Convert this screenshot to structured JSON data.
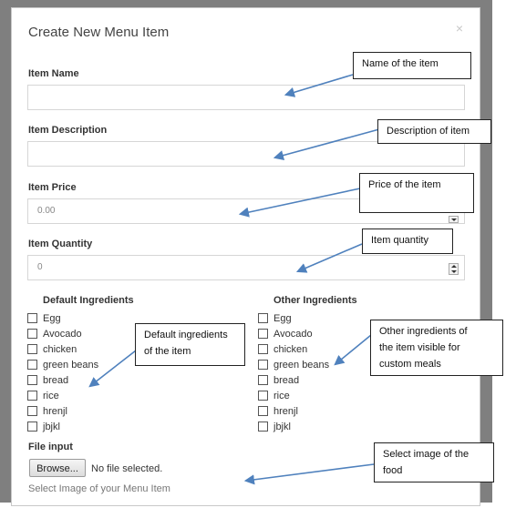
{
  "modal": {
    "title": "Create New Menu Item",
    "close_label": "×"
  },
  "form": {
    "name": {
      "label": "Item Name",
      "value": "",
      "placeholder": ""
    },
    "description": {
      "label": "Item Description",
      "value": "",
      "placeholder": ""
    },
    "price": {
      "label": "Item Price",
      "placeholder": "0.00"
    },
    "quantity": {
      "label": "Item Quantity",
      "placeholder": "0"
    }
  },
  "ingredients": {
    "default": {
      "title": "Default Ingredients",
      "items": [
        "Egg",
        "Avocado",
        "chicken",
        "green beans",
        "bread",
        "rice",
        "hrenjl",
        "jbjkl"
      ]
    },
    "other": {
      "title": "Other Ingredients",
      "items": [
        "Egg",
        "Avocado",
        "chicken",
        "green beans",
        "bread",
        "rice",
        "hrenjl",
        "jbjkl"
      ]
    }
  },
  "file": {
    "label": "File input",
    "button_label": "Browse...",
    "status": "No file selected.",
    "help": "Select Image of your Menu Item"
  },
  "annotations": {
    "name": "Name of the item",
    "description": "Description of item",
    "price": "Price of the item",
    "quantity": "Item quantity",
    "default_ingredients": [
      "Default ingredients",
      "of the item"
    ],
    "other_ingredients": [
      "Other ingredients of",
      "the item visible for",
      "custom meals"
    ],
    "image": [
      "Select image of the",
      "food"
    ]
  },
  "colors": {
    "backdrop": "#7f7f7f",
    "arrow": "#4f81bd",
    "input_border": "#d6d6d6"
  }
}
